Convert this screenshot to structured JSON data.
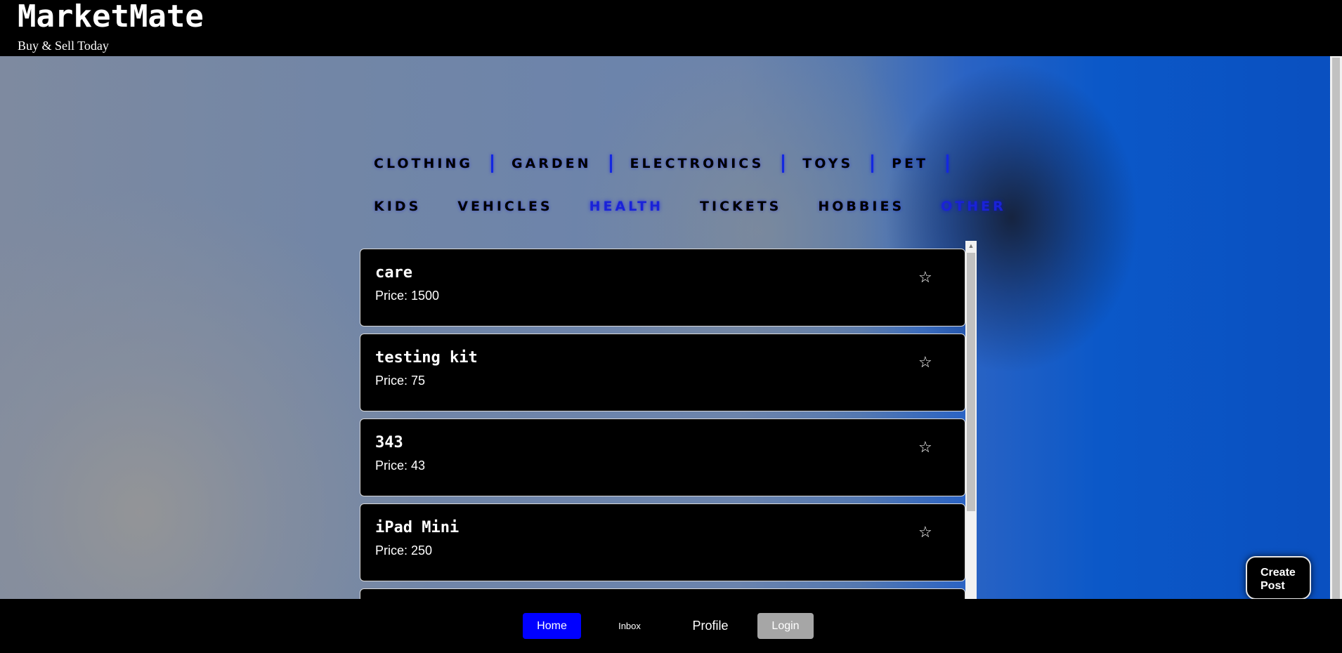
{
  "header": {
    "brand": "MarketMate",
    "tagline": "Buy & Sell Today"
  },
  "categories": {
    "row1": [
      "CLOTHING",
      "GARDEN",
      "ELECTRONICS",
      "TOYS",
      "PET"
    ],
    "row2": [
      "KIDS",
      "VEHICLES",
      "HEALTH",
      "TICKETS",
      "HOBBIES",
      "OTHER"
    ],
    "highlighted": [
      "HEALTH",
      "OTHER"
    ],
    "active_color": "#1a22d8",
    "separator_color": "#1428e0"
  },
  "listings": [
    {
      "title": "care",
      "price": "Price: 1500",
      "favorite_icon": "star-outline-icon"
    },
    {
      "title": "testing kit",
      "price": "Price: 75",
      "favorite_icon": "star-outline-icon"
    },
    {
      "title": "343",
      "price": "Price: 43",
      "favorite_icon": "star-outline-icon"
    },
    {
      "title": "iPad Mini",
      "price": "Price: 250",
      "favorite_icon": "star-outline-icon"
    }
  ],
  "create_post": {
    "label": "Create Post"
  },
  "footer_nav": {
    "home": "Home",
    "inbox": "Inbox",
    "profile": "Profile",
    "login": "Login",
    "home_color": "#0000ff",
    "login_color": "#a6a6a6"
  }
}
